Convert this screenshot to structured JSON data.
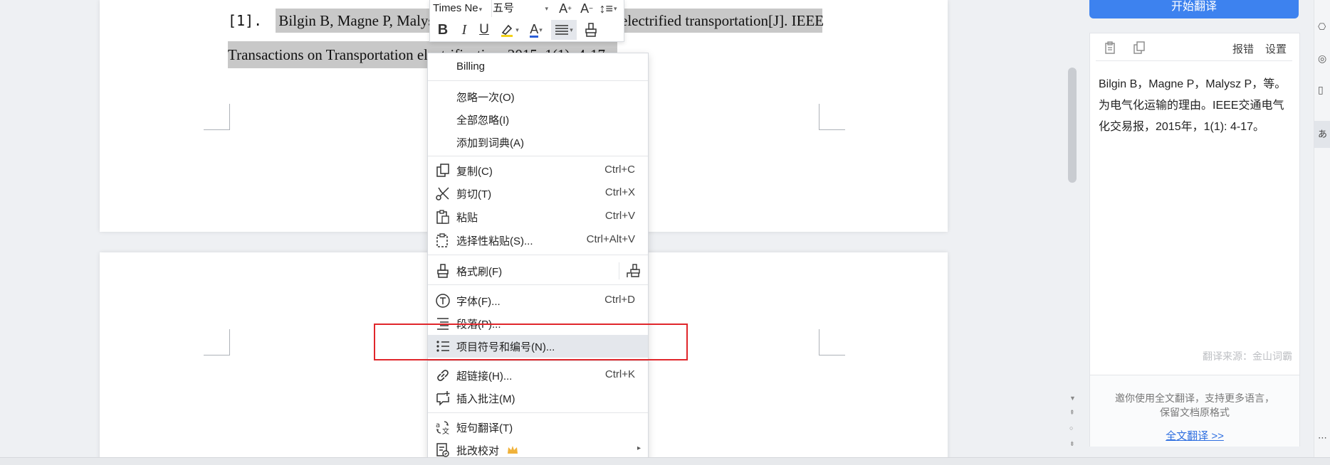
{
  "document": {
    "ref_prefix": "[1].",
    "line1_selected": "Bilgin B, Magne P, Malysz",
    "line1_rest": "electrified transportation[J]. IEEE",
    "line2": "Transactions on Transportation electrification, 2015, 1(1): 4-17."
  },
  "mini_toolbar": {
    "font_name": "Times Ne",
    "font_size": "五号"
  },
  "context_menu": {
    "items": [
      {
        "label": "Billing",
        "shortcut": ""
      },
      {
        "label": "忽略一次(O)",
        "shortcut": ""
      },
      {
        "label": "全部忽略(I)",
        "shortcut": ""
      },
      {
        "label": "添加到词典(A)",
        "shortcut": ""
      },
      {
        "label": "复制(C)",
        "shortcut": "Ctrl+C"
      },
      {
        "label": "剪切(T)",
        "shortcut": "Ctrl+X"
      },
      {
        "label": "粘贴",
        "shortcut": "Ctrl+V"
      },
      {
        "label": "选择性粘贴(S)...",
        "shortcut": "Ctrl+Alt+V"
      },
      {
        "label": "格式刷(F)",
        "shortcut": ""
      },
      {
        "label": "字体(F)...",
        "shortcut": "Ctrl+D"
      },
      {
        "label": "段落(P)...",
        "shortcut": ""
      },
      {
        "label": "项目符号和编号(N)...",
        "shortcut": ""
      },
      {
        "label": "超链接(H)...",
        "shortcut": "Ctrl+K"
      },
      {
        "label": "插入批注(M)",
        "shortcut": ""
      },
      {
        "label": "短句翻译(T)",
        "shortcut": ""
      },
      {
        "label": "批改校对",
        "shortcut": ""
      }
    ]
  },
  "translation_panel": {
    "start_button": "开始翻译",
    "report_error": "报错",
    "settings": "设置",
    "result_text": "Bilgin B，Magne P，Malysz P，等。为电气化运输的理由。IEEE交通电气化交易报，2015年，1(1): 4-17。",
    "source_label": "翻译来源：金山词霸",
    "promo_text": "邀你使用全文翻译，支持更多语言，保留文档原格式",
    "full_translate_link": "全文翻译 >>"
  },
  "colors": {
    "accent_blue": "#3d82ef",
    "highlight_red_box": "#e0262b",
    "selection_gray": "#c8c8c8",
    "menu_highlight": "#e4e7ec",
    "crown_gold": "#f0b23a"
  }
}
